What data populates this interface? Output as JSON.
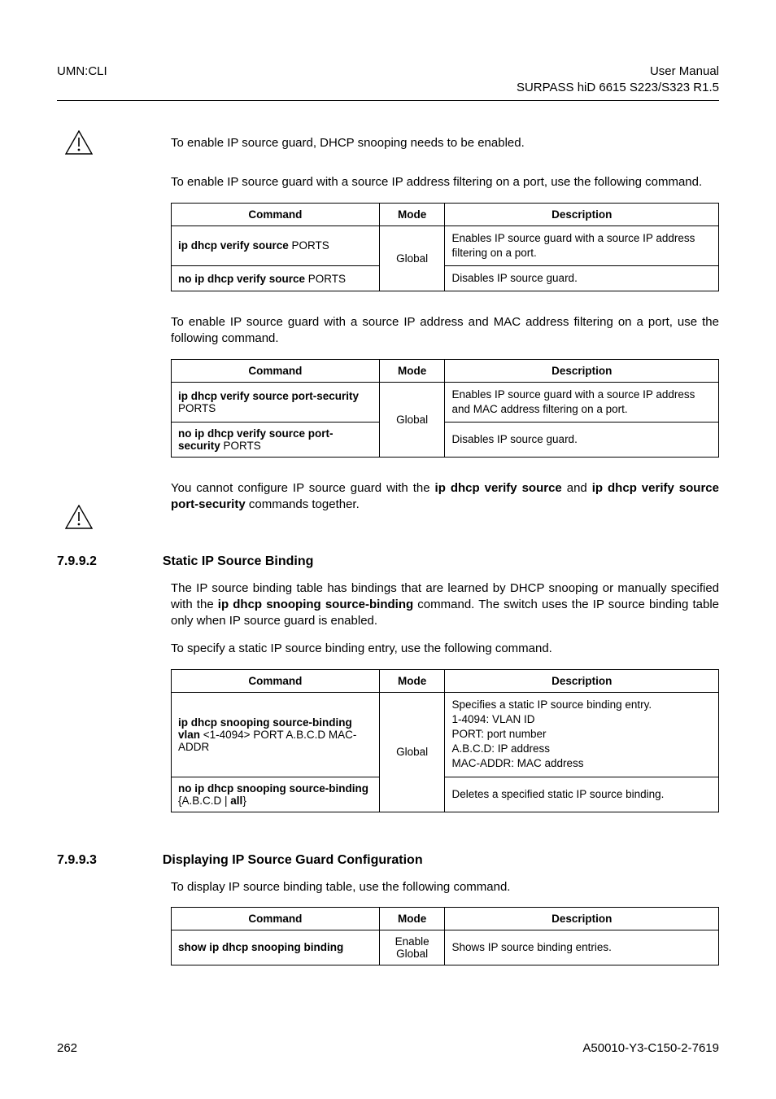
{
  "header": {
    "left": "UMN:CLI",
    "right1": "User Manual",
    "right2": "SURPASS hiD 6615 S223/S323 R1.5"
  },
  "icons": {
    "caution": "caution-triangle"
  },
  "notes": {
    "note1": "To enable IP source guard, DHCP snooping needs to be enabled.",
    "note2_a": "You cannot configure IP source guard with the ",
    "note2_b": "ip dhcp verify source",
    "note2_c": " and ",
    "note2_d": "ip dhcp verify source port-security",
    "note2_e": " commands together."
  },
  "paras": {
    "p1": "To enable IP source guard with a source IP address filtering on a port, use the following command.",
    "p2": "To enable IP source guard with a source IP address and MAC address filtering on a port, use the following command.",
    "p3a": "The IP source binding table has bindings that are learned by DHCP snooping or manually specified with the ",
    "p3b": "ip dhcp snooping source-binding",
    "p3c": " command. The switch uses the IP source binding table only when IP source guard is enabled.",
    "p4": "To specify a static IP source binding entry, use the following command.",
    "p5": "To display IP source binding table, use the following command."
  },
  "table_headers": {
    "cmd": "Command",
    "mode": "Mode",
    "desc": "Description"
  },
  "tbl1": {
    "r1c1a": "ip dhcp verify source ",
    "r1c1b": "PORTS",
    "mode": "Global",
    "r1c3": "Enables IP source guard with a source IP address filtering on a port.",
    "r2c1a": "no ip dhcp verify source ",
    "r2c1b": "PORTS",
    "r2c3": "Disables IP source guard."
  },
  "tbl2": {
    "r1c1a": "ip dhcp verify source port-security ",
    "r1c1b": "PORTS",
    "mode": "Global",
    "r1c3": "Enables IP source guard with a source IP address and MAC address filtering on a port.",
    "r2c1a": "no ip dhcp verify source port-security ",
    "r2c1b": "PORTS",
    "r2c3": "Disables IP source guard."
  },
  "section": {
    "num1": "7.9.9.2",
    "title1": "Static IP Source Binding",
    "num2": "7.9.9.3",
    "title2": "Displaying IP Source Guard Configuration"
  },
  "tbl3": {
    "r1c1": "ip dhcp snooping source-binding vlan <1-4094> PORT A.B.C.D MAC-ADDR",
    "r1c1_a": "ip dhcp snooping source-binding vlan",
    "r1c1_b": " <1-4094> ",
    "r1c1_c": "PORT A.B.C.D MAC-ADDR",
    "mode": "Global",
    "r1c3_l1": "Specifies a static IP source binding entry.",
    "r1c3_l2": "1-4094: VLAN ID",
    "r1c3_l3": "PORT: port number",
    "r1c3_l4": "A.B.C.D: IP address",
    "r1c3_l5": "MAC-ADDR: MAC address",
    "r2c1_a": "no ip dhcp snooping source-binding",
    "r2c1_b": " {",
    "r2c1_c": "A.B.C.D",
    "r2c1_d": " | ",
    "r2c1_e": "all",
    "r2c1_f": "}",
    "r2c3": "Deletes a specified static IP source binding."
  },
  "tbl4": {
    "r1c1": "show ip dhcp snooping binding",
    "mode1": "Enable",
    "mode2": "Global",
    "r1c3": "Shows IP source binding entries."
  },
  "footer": {
    "left": "262",
    "right": "A50010-Y3-C150-2-7619"
  }
}
